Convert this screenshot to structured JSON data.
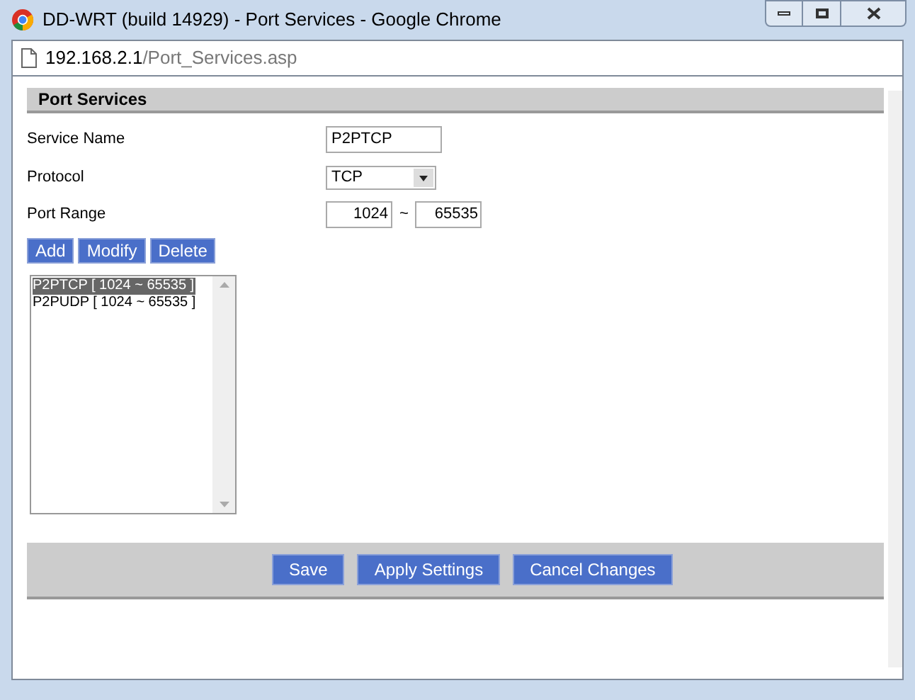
{
  "window": {
    "title": "DD-WRT (build 14929) - Port Services - Google Chrome"
  },
  "address_bar": {
    "host": "192.168.2.1",
    "path": "/Port_Services.asp"
  },
  "section": {
    "title": "Port Services"
  },
  "form": {
    "service_name": {
      "label": "Service Name",
      "value": "P2PTCP"
    },
    "protocol": {
      "label": "Protocol",
      "value": "TCP"
    },
    "port_range": {
      "label": "Port Range",
      "from": "1024",
      "separator": "~",
      "to": "65535"
    }
  },
  "list_buttons": [
    "Add",
    "Modify",
    "Delete"
  ],
  "services": [
    {
      "text": "P2PTCP [ 1024 ~ 65535 ]",
      "selected": true
    },
    {
      "text": "P2PUDP [ 1024 ~ 65535 ]",
      "selected": false
    }
  ],
  "footer_buttons": [
    "Save",
    "Apply Settings",
    "Cancel Changes"
  ]
}
